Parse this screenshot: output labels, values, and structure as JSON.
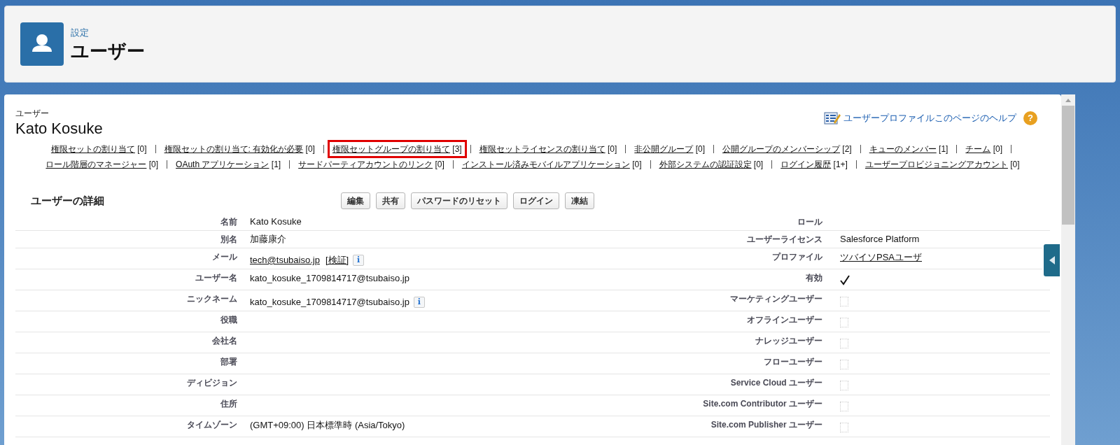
{
  "header": {
    "breadcrumb": "設定",
    "title": "ユーザー"
  },
  "record": {
    "type_label": "ユーザー",
    "name": "Kato Kosuke",
    "help_link": "ユーザープロファイルこのページのヘルプ",
    "help_icon": "?"
  },
  "related_links": [
    [
      {
        "label": "権限セットの割り当て",
        "count": "[0]",
        "highlighted": false
      },
      {
        "label": "権限セットの割り当て: 有効化が必要",
        "count": "[0]",
        "highlighted": false
      },
      {
        "label": "権限セットグループの割り当て",
        "count": "[3]",
        "highlighted": true
      },
      {
        "label": "権限セットライセンスの割り当て",
        "count": "[0]",
        "highlighted": false
      },
      {
        "label": "非公開グループ",
        "count": "[0]",
        "highlighted": false
      },
      {
        "label": "公開グループのメンバーシップ",
        "count": "[2]",
        "highlighted": false
      },
      {
        "label": "キューのメンバー",
        "count": "[1]",
        "highlighted": false
      },
      {
        "label": "チーム",
        "count": "[0]",
        "highlighted": false
      }
    ],
    [
      {
        "label": "ロール階層のマネージャー",
        "count": "[0]",
        "highlighted": false
      },
      {
        "label": "OAuth アプリケーション",
        "count": "[1]",
        "highlighted": false
      },
      {
        "label": "サードパーティアカウントのリンク",
        "count": "[0]",
        "highlighted": false
      },
      {
        "label": "インストール済みモバイルアプリケーション",
        "count": "[0]",
        "highlighted": false
      },
      {
        "label": "外部システムの認証設定",
        "count": "[0]",
        "highlighted": false
      },
      {
        "label": "ログイン履歴",
        "count": "[1+]",
        "highlighted": false
      },
      {
        "label": "ユーザープロビジョニングアカウント",
        "count": "[0]",
        "highlighted": false
      }
    ]
  ],
  "detail": {
    "title": "ユーザーの詳細",
    "buttons": [
      "編集",
      "共有",
      "パスワードのリセット",
      "ログイン",
      "凍結"
    ],
    "rows": [
      {
        "left": {
          "label": "名前",
          "kind": "text",
          "value": "Kato Kosuke"
        },
        "right": {
          "label": "ロール",
          "kind": "text"
        }
      },
      {
        "left": {
          "label": "別名",
          "kind": "text",
          "value": "加藤康介"
        },
        "right": {
          "label": "ユーザーライセンス",
          "kind": "text",
          "value": "Salesforce Platform"
        }
      },
      {
        "left": {
          "label": "メール",
          "kind": "email",
          "value": "tech@tsubaiso.jp",
          "action": "[検証]",
          "info_icon": "i"
        },
        "right": {
          "label": "プロファイル",
          "kind": "link",
          "value": "ツバイソPSAユーザ"
        }
      },
      {
        "left": {
          "label": "ユーザー名",
          "kind": "text",
          "value": "kato_kosuke_1709814717@tsubaiso.jp"
        },
        "right": {
          "label": "有効",
          "kind": "checkbox",
          "checked": true
        }
      },
      {
        "left": {
          "label": "ニックネーム",
          "kind": "text_info",
          "value": "kato_kosuke_1709814717@tsubaiso.jp",
          "info_icon": "i"
        },
        "right": {
          "label": "マーケティングユーザー",
          "kind": "checkbox",
          "checked": false
        }
      },
      {
        "left": {
          "label": "役職",
          "kind": "text"
        },
        "right": {
          "label": "オフラインユーザー",
          "kind": "checkbox",
          "checked": false
        }
      },
      {
        "left": {
          "label": "会社名",
          "kind": "text"
        },
        "right": {
          "label": "ナレッジユーザー",
          "kind": "checkbox",
          "checked": false
        }
      },
      {
        "left": {
          "label": "部署",
          "kind": "text"
        },
        "right": {
          "label": "フローユーザー",
          "kind": "checkbox",
          "checked": false
        }
      },
      {
        "left": {
          "label": "ディビジョン",
          "kind": "text"
        },
        "right": {
          "label": "Service Cloud ユーザー",
          "kind": "checkbox",
          "checked": false
        }
      },
      {
        "left": {
          "label": "住所",
          "kind": "text"
        },
        "right": {
          "label": "Site.com Contributor ユーザー",
          "kind": "checkbox",
          "checked": false
        }
      },
      {
        "left": {
          "label": "タイムゾーン",
          "kind": "text",
          "value": "(GMT+09:00) 日本標準時 (Asia/Tokyo)"
        },
        "right": {
          "label": "Site.com Publisher ユーザー",
          "kind": "checkbox",
          "checked": false
        }
      }
    ]
  }
}
